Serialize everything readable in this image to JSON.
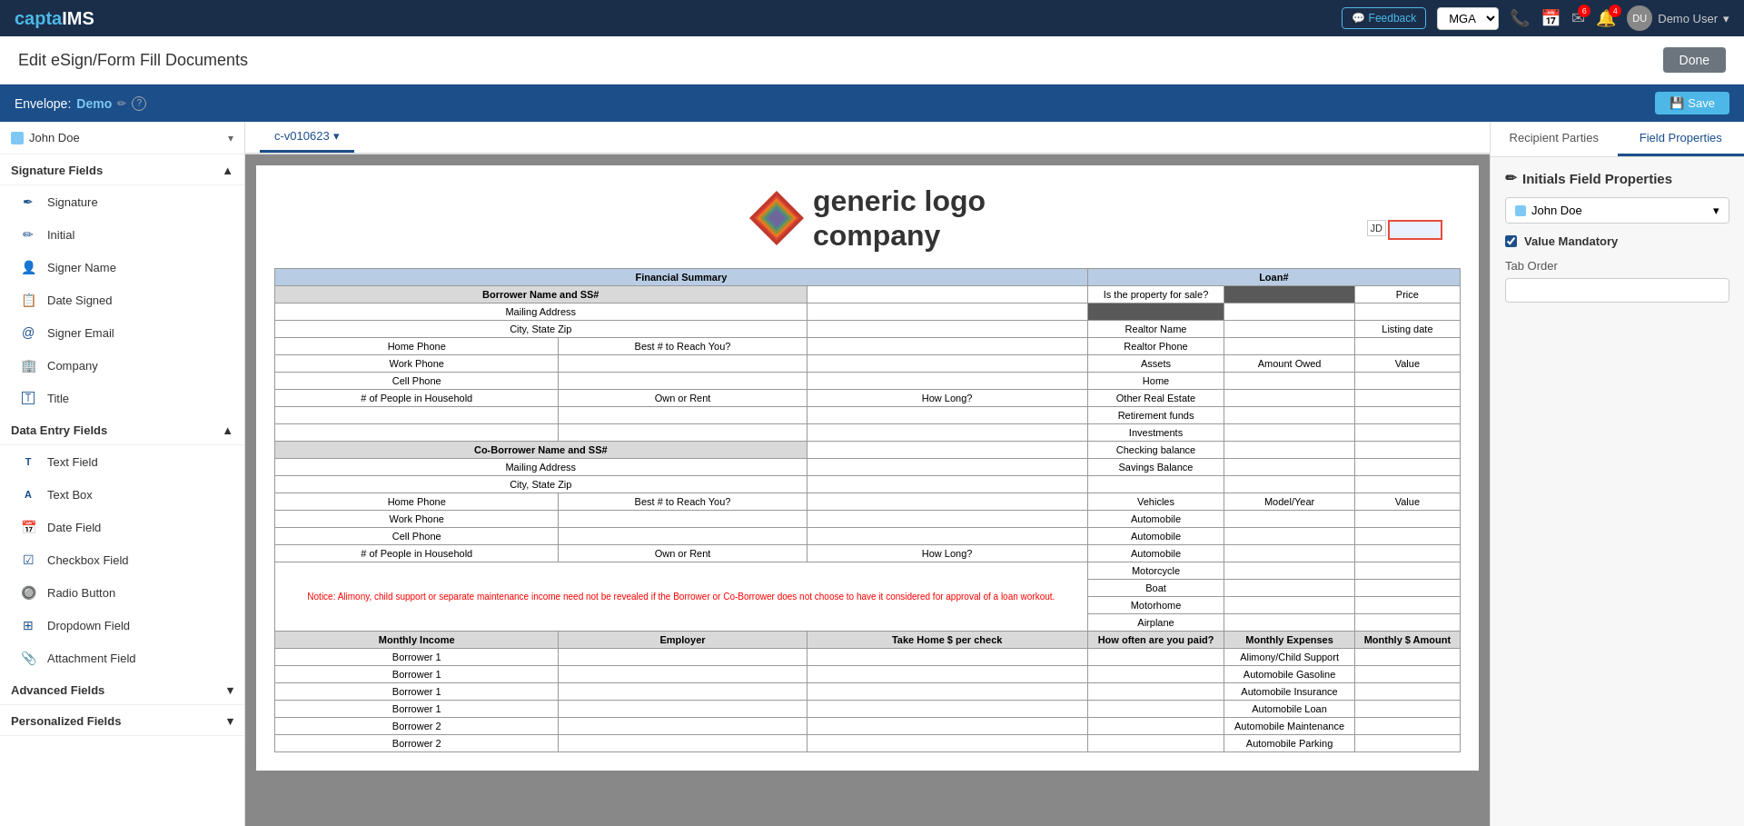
{
  "app": {
    "logo_prefix": "capta",
    "logo_suffix": "IMS"
  },
  "topnav": {
    "feedback_label": "Feedback",
    "mga_label": "MGA",
    "phone_icon": "📞",
    "calendar_icon": "📅",
    "email_icon": "✉",
    "bell_icon": "🔔",
    "email_badge": "6",
    "bell_badge": "4",
    "user_label": "Demo User",
    "avatar_initials": "DU"
  },
  "page": {
    "title": "Edit eSign/Form Fill Documents",
    "done_label": "Done"
  },
  "envelope": {
    "label": "Envelope:",
    "name": "Demo",
    "help": "?",
    "save_label": "Save"
  },
  "document_tab": {
    "id": "c-v010623",
    "dropdown_icon": "▾"
  },
  "sidebar": {
    "user_name": "John Doe",
    "signature_fields_label": "Signature Fields",
    "fields": {
      "signature": "Signature",
      "initial": "Initial",
      "signer_name": "Signer Name",
      "date_signed": "Date Signed",
      "signer_email": "Signer Email",
      "company": "Company",
      "title": "Title"
    },
    "data_entry_label": "Data Entry Fields",
    "data_fields": {
      "text_field": "Text Field",
      "text_box": "Text Box",
      "date_field": "Date Field",
      "checkbox_field": "Checkbox Field",
      "radio_button": "Radio Button",
      "dropdown_field": "Dropdown Field",
      "attachment_field": "Attachment Field"
    },
    "advanced_label": "Advanced Fields",
    "personalized_label": "Personalized Fields"
  },
  "right_panel": {
    "tab_recipient": "Recipient Parties",
    "tab_field_props": "Field Properties",
    "title": "Initials Field Properties",
    "pencil_icon": "✏",
    "user_name": "John Doe",
    "value_mandatory_label": "Value Mandatory",
    "tab_order_label": "Tab Order",
    "tab_order_value": ""
  },
  "document": {
    "logo_text_line1": "generic logo",
    "logo_text_line2": "company",
    "initials_label": "JD",
    "table": {
      "headers": [
        "Financial Summary",
        "Loan#"
      ],
      "rows": [
        [
          "Borrower Name and SS#",
          "",
          "Is the property for sale?",
          "",
          "Price"
        ],
        [
          "Mailing Address",
          "",
          "",
          "",
          ""
        ],
        [
          "City, State Zip",
          "",
          "Realtor Name",
          "",
          "Listing date"
        ],
        [
          "Home Phone",
          "Best # to Reach You?",
          "Realtor Phone",
          "",
          ""
        ],
        [
          "Work Phone",
          "",
          "Assets",
          "Amount Owed",
          "Value"
        ],
        [
          "Cell Phone",
          "",
          "Home",
          "",
          ""
        ],
        [
          "# of People in Household",
          "Own or Rent",
          "How Long?",
          "Other Real Estate",
          ""
        ],
        [
          "",
          "",
          "",
          "Retirement funds",
          ""
        ],
        [
          "",
          "",
          "",
          "Investments",
          ""
        ],
        [
          "Co-Borrower Name and SS#",
          "",
          "Checking balance",
          "",
          ""
        ],
        [
          "Mailing Address",
          "",
          "Savings Balance",
          "",
          ""
        ],
        [
          "City, State Zip",
          "",
          "",
          "",
          ""
        ],
        [
          "Home Phone",
          "Best # to Reach You?",
          "Vehicles",
          "Model/Year",
          "Value"
        ],
        [
          "Work Phone",
          "",
          "Automobile",
          "",
          ""
        ],
        [
          "Cell Phone",
          "",
          "Automobile",
          "",
          ""
        ],
        [
          "# of People in Household",
          "Own or Rent",
          "How Long?",
          "Automobile",
          ""
        ],
        [
          "",
          "",
          "",
          "Motorcycle",
          ""
        ],
        [
          "",
          "",
          "",
          "Boat",
          ""
        ],
        [
          "",
          "",
          "",
          "Motorhome",
          ""
        ],
        [
          "",
          "",
          "",
          "Airplane",
          ""
        ]
      ],
      "notice": "Notice: Alimony, child support or separate maintenance income need not be revealed if the Borrower or Co-Borrower does not choose to have it considered for approval of a loan workout.",
      "income_headers": [
        "Monthly Income",
        "Employer",
        "Take Home $ per check",
        "How often are you paid?",
        "Monthly Expenses",
        "Monthly $ Amount"
      ],
      "income_rows": [
        [
          "Borrower 1",
          "",
          "",
          "",
          "Alimony/Child Support",
          ""
        ],
        [
          "Borrower 1",
          "",
          "",
          "",
          "Automobile Gasoline",
          ""
        ],
        [
          "Borrower 1",
          "",
          "",
          "",
          "Automobile Insurance",
          ""
        ],
        [
          "Borrower 1",
          "",
          "",
          "",
          "Automobile Loan",
          ""
        ],
        [
          "Borrower 2",
          "",
          "",
          "",
          "Automobile Maintenance",
          ""
        ],
        [
          "Borrower 2",
          "",
          "",
          "",
          "Automobile Parking",
          ""
        ]
      ]
    }
  }
}
